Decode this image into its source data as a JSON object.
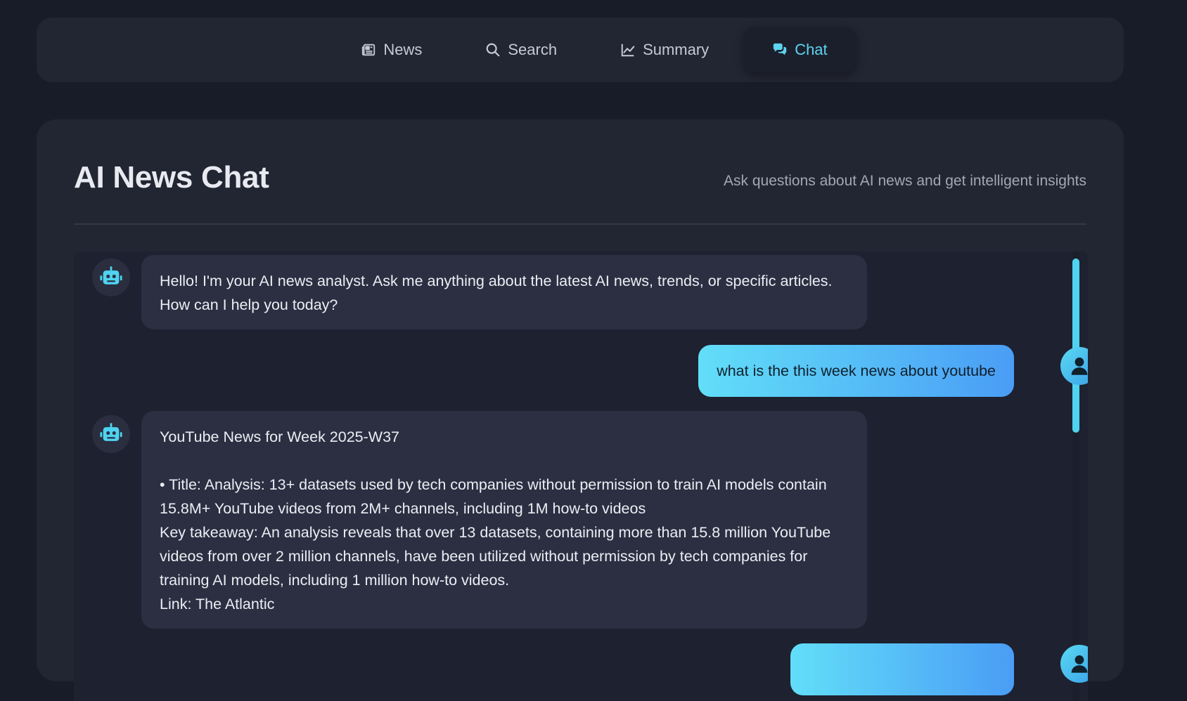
{
  "nav": {
    "items": [
      {
        "label": "News",
        "icon": "newspaper-icon"
      },
      {
        "label": "Search",
        "icon": "search-icon"
      },
      {
        "label": "Summary",
        "icon": "line-chart-icon"
      },
      {
        "label": "Chat",
        "icon": "chat-bubbles-icon",
        "active": true
      }
    ]
  },
  "header": {
    "title": "AI News Chat",
    "subtitle": "Ask questions about AI news and get intelligent insights"
  },
  "messages": {
    "bot_greeting": "Hello! I'm your AI news analyst. Ask me anything about the latest AI news, trends, or specific articles. How can I help you today?",
    "user_question": "what is the this week news about youtube",
    "bot_answer": {
      "heading": "YouTube News for Week 2025-W37",
      "title_line": "• Title: Analysis: 13+ datasets used by tech companies without permission to train AI models contain 15.8M+ YouTube videos from 2M+ channels, including 1M how-to videos",
      "takeaway": "Key takeaway: An analysis reveals that over 13 datasets, containing more than 15.8 million YouTube videos from over 2 million channels, have been utilized without permission by tech companies for training AI models, including 1 million how-to videos.",
      "link": "Link: The Atlantic"
    }
  },
  "colors": {
    "accent": "#5fd4ef",
    "background": "#181c28",
    "panel": "#222532",
    "bot_bubble": "#2c2f42",
    "user_bubble_start": "#62def8",
    "user_bubble_end": "#4a9df5"
  }
}
